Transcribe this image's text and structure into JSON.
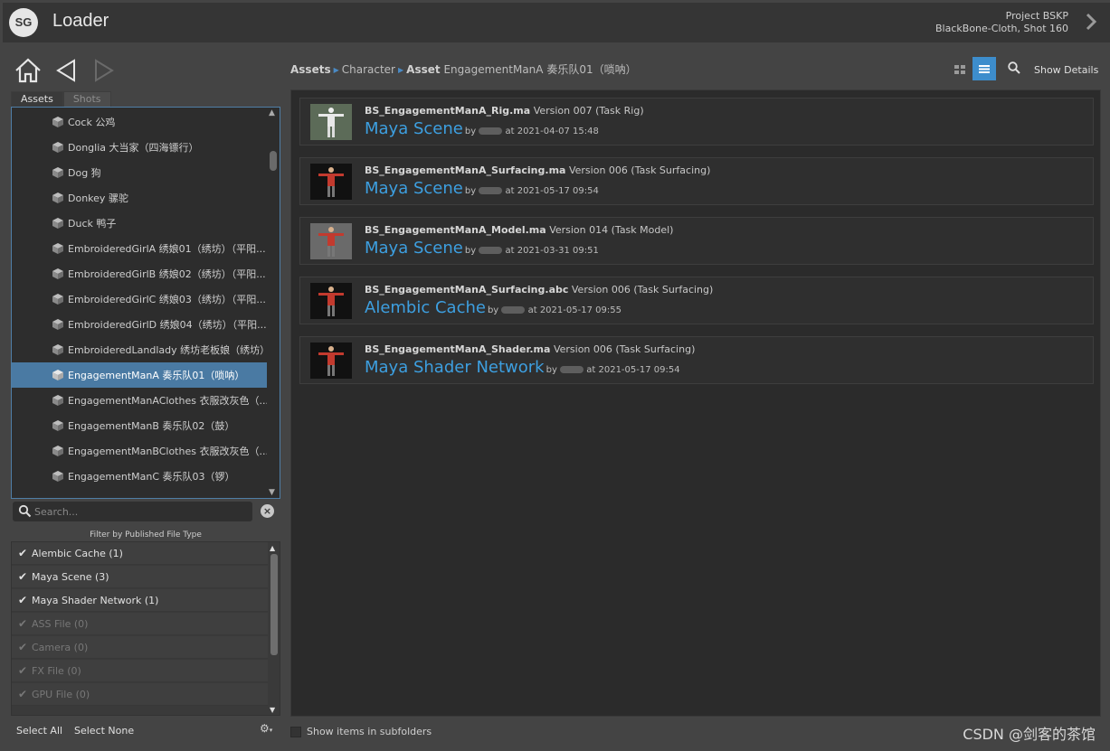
{
  "app": {
    "logo_text": "SG",
    "title": "Loader",
    "project": "Project BSKP",
    "context": "BlackBone-Cloth, Shot 160"
  },
  "tabs": [
    {
      "label": "Assets",
      "active": true
    },
    {
      "label": "Shots",
      "active": false
    }
  ],
  "tree": {
    "items": [
      {
        "label": "Cock 公鸡",
        "selected": false
      },
      {
        "label": "Donglia 大当家（四海镖行）",
        "selected": false
      },
      {
        "label": "Dog 狗",
        "selected": false
      },
      {
        "label": "Donkey 骡驼",
        "selected": false
      },
      {
        "label": "Duck 鸭子",
        "selected": false
      },
      {
        "label": "EmbroideredGirlA 绣娘01（绣坊）（平阳...",
        "selected": false
      },
      {
        "label": "EmbroideredGirlB 绣娘02（绣坊）（平阳...",
        "selected": false
      },
      {
        "label": "EmbroideredGirlC 绣娘03（绣坊）（平阳...",
        "selected": false
      },
      {
        "label": "EmbroideredGirlD 绣娘04（绣坊）（平阳...",
        "selected": false
      },
      {
        "label": "EmbroideredLandlady 绣坊老板娘（绣坊）",
        "selected": false
      },
      {
        "label": "EngagementManA 奏乐队01（唢呐）",
        "selected": true
      },
      {
        "label": "EngagementManAClothes 衣服改灰色（...",
        "selected": false
      },
      {
        "label": "EngagementManB 奏乐队02（鼓）",
        "selected": false
      },
      {
        "label": "EngagementManBClothes 衣服改灰色（...",
        "selected": false
      },
      {
        "label": "EngagementManC 奏乐队03（锣）",
        "selected": false
      }
    ]
  },
  "search": {
    "placeholder": "Search..."
  },
  "filter": {
    "title": "Filter by Published File Type",
    "items": [
      {
        "label": "Alembic Cache (1)",
        "checked": true
      },
      {
        "label": "Maya Scene (3)",
        "checked": true
      },
      {
        "label": "Maya Shader Network (1)",
        "checked": true
      },
      {
        "label": "ASS File (0)",
        "checked": false
      },
      {
        "label": "Camera (0)",
        "checked": false
      },
      {
        "label": "FX File (0)",
        "checked": false
      },
      {
        "label": "GPU File (0)",
        "checked": false
      }
    ],
    "select_all": "Select All",
    "select_none": "Select None"
  },
  "breadcrumb": {
    "root": "Assets",
    "level1": "Character",
    "current_type": "Asset",
    "current_name": "EngagementManA 奏乐队01（唢呐）"
  },
  "toolbar": {
    "show_details": "Show Details"
  },
  "results": [
    {
      "file": "BS_EngagementManA_Rig.ma",
      "version": "Version 007 (Task Rig)",
      "type": "Maya Scene",
      "by": "by",
      "at": "at 2021-04-07 15:48"
    },
    {
      "file": "BS_EngagementManA_Surfacing.ma",
      "version": "Version 006 (Task Surfacing)",
      "type": "Maya Scene",
      "by": "by",
      "at": "at 2021-05-17 09:54"
    },
    {
      "file": "BS_EngagementManA_Model.ma",
      "version": "Version 014 (Task Model)",
      "type": "Maya Scene",
      "by": "by",
      "at": "at 2021-03-31 09:51"
    },
    {
      "file": "BS_EngagementManA_Surfacing.abc",
      "version": "Version 006 (Task Surfacing)",
      "type": "Alembic Cache",
      "by": "by",
      "at": "at 2021-05-17 09:55"
    },
    {
      "file": "BS_EngagementManA_Shader.ma",
      "version": "Version 006 (Task Surfacing)",
      "type": "Maya Shader Network",
      "by": "by",
      "at": "at 2021-05-17 09:54"
    }
  ],
  "footer": {
    "subfolders_label": "Show items in subfolders",
    "watermark": "CSDN @剑客的茶馆"
  },
  "colors": {
    "accent": "#3d9fe0",
    "selection": "#4a7aa3",
    "panel": "#2b2b2b"
  }
}
